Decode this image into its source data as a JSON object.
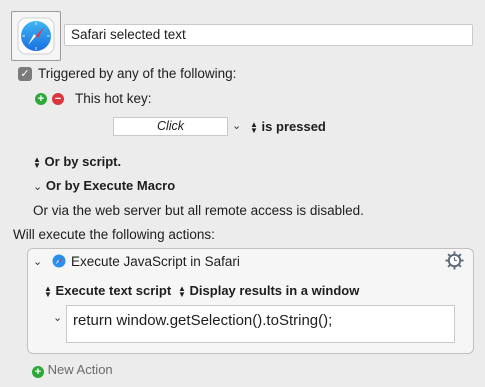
{
  "macro": {
    "name": "Safari selected text",
    "icon": "safari-compass-icon"
  },
  "trigger": {
    "checkbox_checked": true,
    "label": "Triggered by any of the following:",
    "hotkey": {
      "label": "This hot key:",
      "key_value": "Click",
      "condition": "is pressed"
    },
    "or_script": "Or by script.",
    "or_execute_macro": "Or by Execute Macro",
    "web_server_note": "Or via the web server but all remote access is disabled."
  },
  "actions": {
    "header": "Will execute the following actions:",
    "items": [
      {
        "title": "Execute JavaScript in Safari",
        "icon": "safari-compass-icon",
        "mode": "Execute text script",
        "output": "Display results in a window",
        "script": "return window.getSelection().toString();"
      }
    ],
    "new_action": "New Action"
  },
  "colors": {
    "add": "#2fa83a",
    "remove": "#d9363e",
    "background": "#ececec"
  }
}
